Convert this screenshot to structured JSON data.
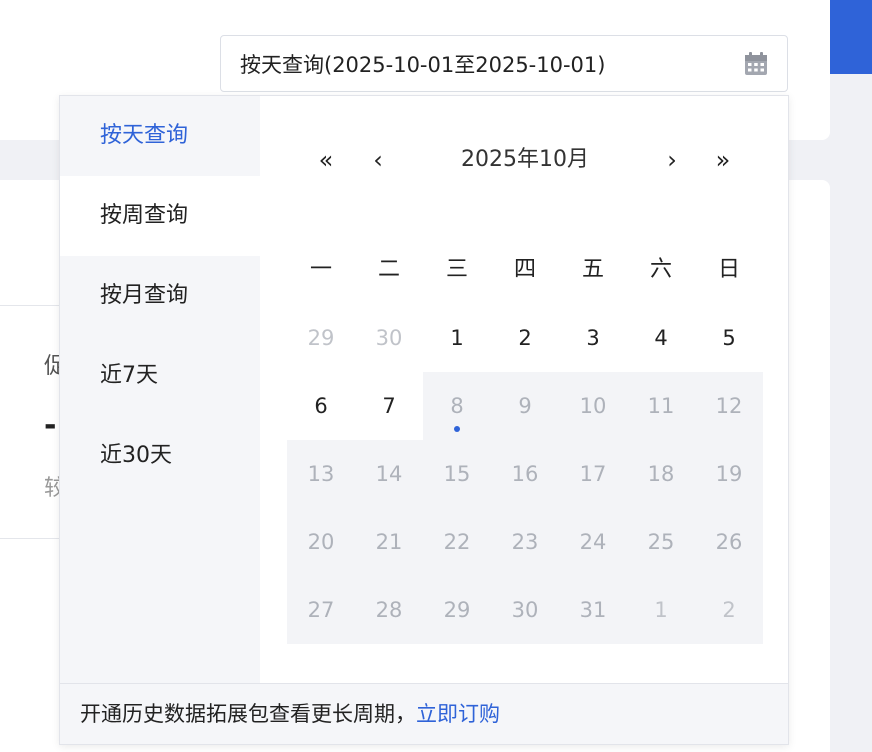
{
  "background": {
    "fragments": [
      "促",
      "-",
      "较"
    ]
  },
  "date_input": {
    "value": "按天查询(2025-10-01至2025-10-01)",
    "icon": "calendar-icon"
  },
  "sidebar": {
    "items": [
      {
        "label": "按天查询",
        "active": true
      },
      {
        "label": "按周查询",
        "active": false
      },
      {
        "label": "按月查询",
        "active": false
      },
      {
        "label": "近7天",
        "active": false
      },
      {
        "label": "近30天",
        "active": false
      }
    ]
  },
  "calendar": {
    "nav": {
      "prev_year": "«",
      "prev_month": "‹",
      "next_month": "›",
      "next_year": "»"
    },
    "title": "2025年10月",
    "weekdays": [
      "一",
      "二",
      "三",
      "四",
      "五",
      "六",
      "日"
    ],
    "weeks": [
      [
        "29",
        "30",
        "1",
        "2",
        "3",
        "4",
        "5"
      ],
      [
        "6",
        "7",
        "8",
        "9",
        "10",
        "11",
        "12"
      ],
      [
        "13",
        "14",
        "15",
        "16",
        "17",
        "18",
        "19"
      ],
      [
        "20",
        "21",
        "22",
        "23",
        "24",
        "25",
        "26"
      ],
      [
        "27",
        "28",
        "29",
        "30",
        "31",
        "1",
        "2"
      ]
    ],
    "today": "8"
  },
  "footer": {
    "text": "开通历史数据拓展包查看更长周期，",
    "link": "立即订购"
  },
  "colors": {
    "accent": "#2f63d8"
  }
}
